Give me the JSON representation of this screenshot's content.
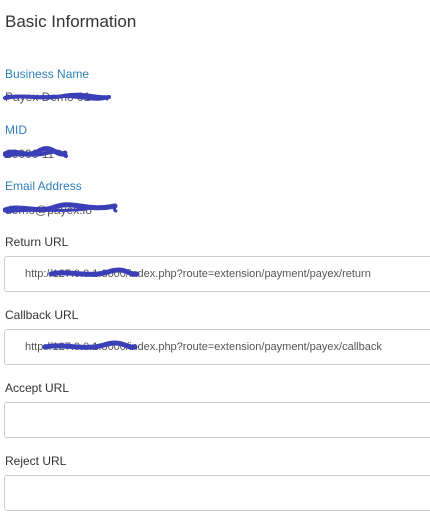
{
  "section": {
    "title": "Basic Information"
  },
  "info": {
    "business_name_label": "Business Name",
    "business_name_value": "Payex Demo 01",
    "mid_label": "MID",
    "mid_value": "10000 11",
    "email_label": "Email Address",
    "email_value": "demo@payex.io"
  },
  "fields": {
    "return_url_label": "Return URL",
    "return_url_value": "http://127.0.0.1:8000/index.php?route=extension/payment/payex/return",
    "callback_url_label": "Callback URL",
    "callback_url_value": "http://127.0.0.1:8000/index.php?route=extension/payment/payex/callback",
    "accept_url_label": "Accept URL",
    "accept_url_value": "",
    "reject_url_label": "Reject URL",
    "reject_url_value": ""
  },
  "colors": {
    "accent_label": "#2e7eb8",
    "redaction": "#3a3fb8"
  }
}
